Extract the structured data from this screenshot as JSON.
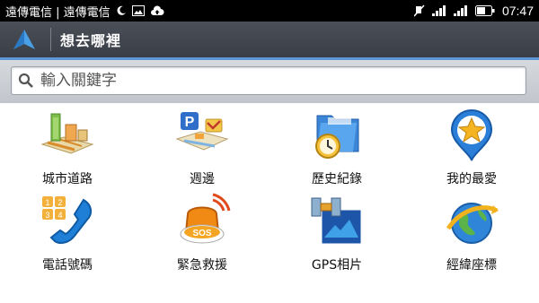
{
  "status_bar": {
    "carriers": "遠傳電信 | 遠傳電信",
    "time": "07:47"
  },
  "header": {
    "title": "想去哪裡",
    "logo_icon": "navigation-arrow-icon"
  },
  "search": {
    "placeholder": "輸入關鍵字",
    "icon": "search-icon"
  },
  "grid": {
    "items": [
      {
        "label": "城市道路",
        "icon": "city-map-icon"
      },
      {
        "label": "週邊",
        "icon": "parking-nearby-icon"
      },
      {
        "label": "歷史紀錄",
        "icon": "history-folder-clock-icon"
      },
      {
        "label": "我的最愛",
        "icon": "favorite-star-pin-icon"
      },
      {
        "label": "電話號碼",
        "icon": "phone-keypad-icon"
      },
      {
        "label": "緊急救援",
        "icon": "sos-siren-icon"
      },
      {
        "label": "GPS相片",
        "icon": "gps-satellite-photo-icon"
      },
      {
        "label": "經緯座標",
        "icon": "globe-coordinates-icon"
      }
    ]
  },
  "colors": {
    "statusbar": "#000000",
    "actionbar": "#40444c",
    "accent": "#5d96d6",
    "search_area": "#cbcfd4"
  }
}
